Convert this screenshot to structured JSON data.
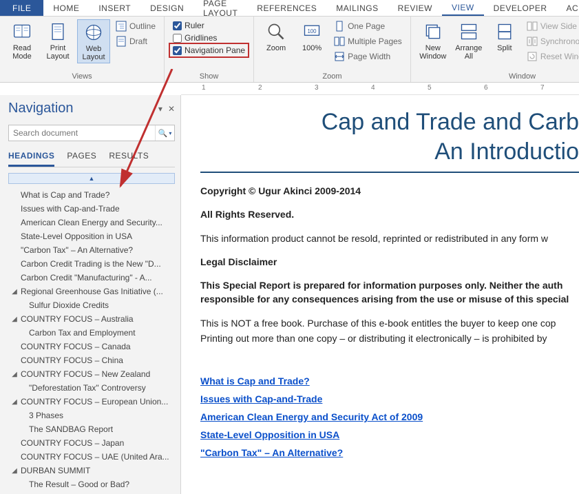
{
  "tabs": {
    "file": "FILE",
    "items": [
      "HOME",
      "INSERT",
      "DESIGN",
      "PAGE LAYOUT",
      "REFERENCES",
      "MAILINGS",
      "REVIEW",
      "VIEW",
      "DEVELOPER",
      "ACROBAT"
    ],
    "active": "VIEW"
  },
  "ribbon": {
    "views": {
      "label": "Views",
      "read_mode": "Read\nMode",
      "print_layout": "Print\nLayout",
      "web_layout": "Web\nLayout",
      "outline": "Outline",
      "draft": "Draft"
    },
    "show": {
      "label": "Show",
      "ruler": "Ruler",
      "gridlines": "Gridlines",
      "navigation_pane": "Navigation Pane",
      "ruler_checked": true,
      "gridlines_checked": false,
      "navigation_pane_checked": true
    },
    "zoom": {
      "label": "Zoom",
      "zoom_btn": "Zoom",
      "hundred": "100%",
      "one_page": "One Page",
      "multiple_pages": "Multiple Pages",
      "page_width": "Page Width"
    },
    "window": {
      "label": "Window",
      "new_window": "New\nWindow",
      "arrange_all": "Arrange\nAll",
      "split": "Split",
      "side_by_side": "View Side by Side",
      "sync_scroll": "Synchronous Scrolling",
      "reset_pos": "Reset Window Position"
    }
  },
  "ruler_numbers": [
    "1",
    "2",
    "3",
    "4",
    "5",
    "6",
    "7"
  ],
  "nav": {
    "title": "Navigation",
    "search_placeholder": "Search document",
    "tabs": {
      "headings": "HEADINGS",
      "pages": "PAGES",
      "results": "RESULTS"
    },
    "items": [
      {
        "level": 1,
        "tw": "",
        "label": "What is Cap and Trade?"
      },
      {
        "level": 1,
        "tw": "",
        "label": "Issues with Cap-and-Trade"
      },
      {
        "level": 1,
        "tw": "",
        "label": "American Clean Energy and Security..."
      },
      {
        "level": 1,
        "tw": "",
        "label": "State-Level Opposition in USA"
      },
      {
        "level": 1,
        "tw": "",
        "label": "\"Carbon Tax\" – An Alternative?"
      },
      {
        "level": 1,
        "tw": "",
        "label": "Carbon Credit Trading is the New \"D..."
      },
      {
        "level": 1,
        "tw": "",
        "label": "Carbon Credit \"Manufacturing\" - A..."
      },
      {
        "level": 1,
        "tw": "◢",
        "label": "Regional Greenhouse Gas Initiative (..."
      },
      {
        "level": 2,
        "tw": "",
        "label": "Sulfur Dioxide Credits"
      },
      {
        "level": 1,
        "tw": "◢",
        "label": "COUNTRY FOCUS – Australia"
      },
      {
        "level": 2,
        "tw": "",
        "label": "Carbon Tax and Employment"
      },
      {
        "level": 1,
        "tw": "",
        "label": "COUNTRY FOCUS – Canada"
      },
      {
        "level": 1,
        "tw": "",
        "label": "COUNTRY FOCUS – China"
      },
      {
        "level": 1,
        "tw": "◢",
        "label": "COUNTRY FOCUS – New Zealand"
      },
      {
        "level": 2,
        "tw": "",
        "label": "\"Deforestation Tax\" Controversy"
      },
      {
        "level": 1,
        "tw": "◢",
        "label": "COUNTRY FOCUS – European Union..."
      },
      {
        "level": 2,
        "tw": "",
        "label": "3 Phases"
      },
      {
        "level": 2,
        "tw": "",
        "label": "The SANDBAG Report"
      },
      {
        "level": 1,
        "tw": "",
        "label": "COUNTRY FOCUS – Japan"
      },
      {
        "level": 1,
        "tw": "",
        "label": "COUNTRY FOCUS – UAE (United Ara..."
      },
      {
        "level": 1,
        "tw": "◢",
        "label": "DURBAN SUMMIT"
      },
      {
        "level": 2,
        "tw": "",
        "label": "The Result – Good or Bad?"
      }
    ]
  },
  "doc": {
    "title_line1": "Cap and Trade and Carb",
    "title_line2": "An Introductio",
    "copyright": "Copyright © Ugur Akinci 2009-2014",
    "rights": "All Rights Reserved.",
    "p1": "This information product cannot be resold, reprinted or redistributed in any form w",
    "legal_head": "Legal Disclaimer",
    "legal_body": "This Special Report is prepared for information purposes only. Neither the auth responsible for any consequences arising from the use or misuse of this special",
    "p2a": "This is NOT a free book. Purchase of this e-book entitles the buyer to keep one cop",
    "p2b": "Printing out more than one copy – or distributing it electronically – is prohibited by",
    "links": [
      "What is Cap and Trade?",
      "Issues with Cap-and-Trade",
      "American Clean Energy and Security Act of 2009",
      "State-Level Opposition in USA",
      "\"Carbon Tax\" – An Alternative?"
    ]
  }
}
